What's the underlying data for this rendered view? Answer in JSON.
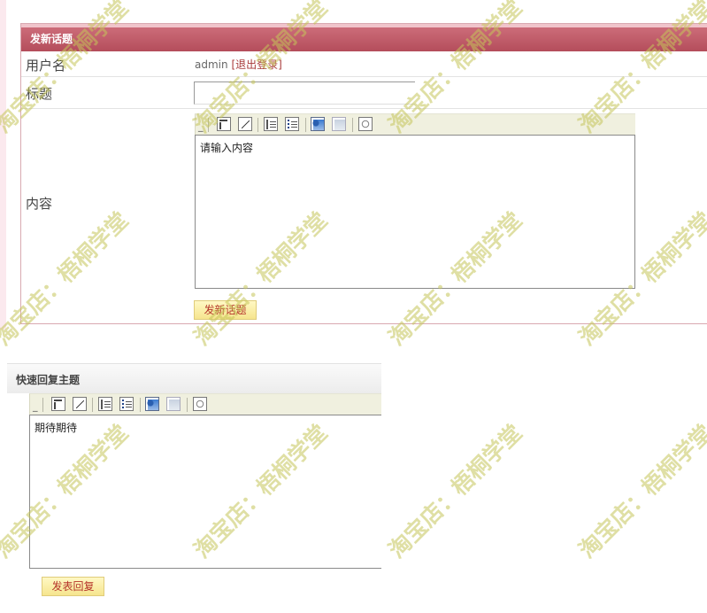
{
  "new_topic": {
    "header": "发新话题",
    "username_label": "用户名",
    "username_value": "admin",
    "logout_open": "[",
    "logout_label": "退出登录",
    "logout_close": "]",
    "title_label": "标题",
    "title_value": "",
    "content_label": "内容",
    "content_value": "请输入内容",
    "submit_label": "发新话题"
  },
  "quick_reply": {
    "header": "快速回复主题",
    "content_value": "期待期待",
    "submit_label": "发表回复"
  },
  "toolbar_icons": [
    "bold-icon",
    "italic-icon",
    "ordered-list-icon",
    "unordered-list-icon",
    "insert-image-icon",
    "image-disabled-icon",
    "emoticon-icon"
  ],
  "watermark": "淘宝店：梧桐学堂"
}
